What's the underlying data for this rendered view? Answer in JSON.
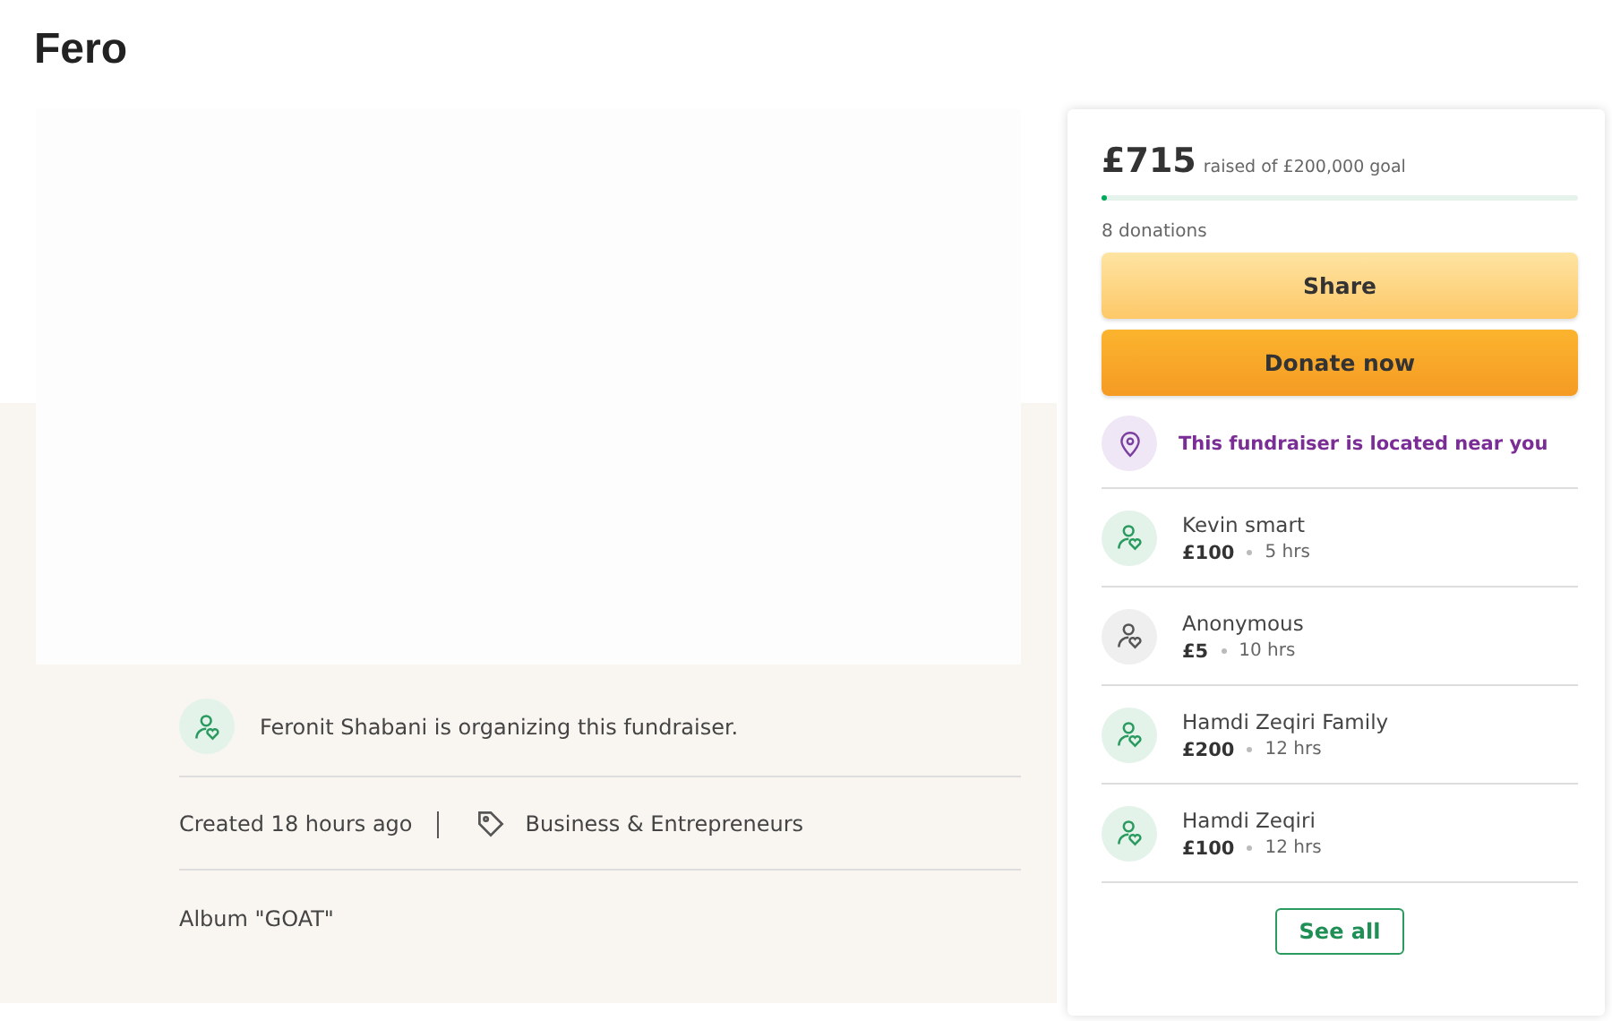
{
  "title": "Fero",
  "organizer": {
    "text": "Feronit Shabani is organizing this fundraiser."
  },
  "meta": {
    "created": "Created 18 hours ago",
    "category": "Business & Entrepreneurs"
  },
  "description": "Album \"GOAT\"",
  "card": {
    "raised": "£715",
    "goal": "raised of £200,000 goal",
    "level": 0.004,
    "donations": "8 donations",
    "buttons": [
      {
        "label": "Share",
        "kind": "share"
      },
      {
        "label": "Donate now",
        "kind": "donate"
      }
    ],
    "location": "This fundraiser is located near you",
    "donors": [
      {
        "name": "Kevin smart",
        "amount": "£100",
        "time": "5 hrs",
        "anonymous": false
      },
      {
        "name": "Anonymous",
        "amount": "£5",
        "time": "10 hrs",
        "anonymous": true
      },
      {
        "name": "Hamdi Zeqiri Family",
        "amount": "£200",
        "time": "12 hrs",
        "anonymous": false
      },
      {
        "name": "Hamdi Zeqiri",
        "amount": "£100",
        "time": "12 hrs",
        "anonymous": false
      }
    ],
    "see_all": "See all"
  }
}
